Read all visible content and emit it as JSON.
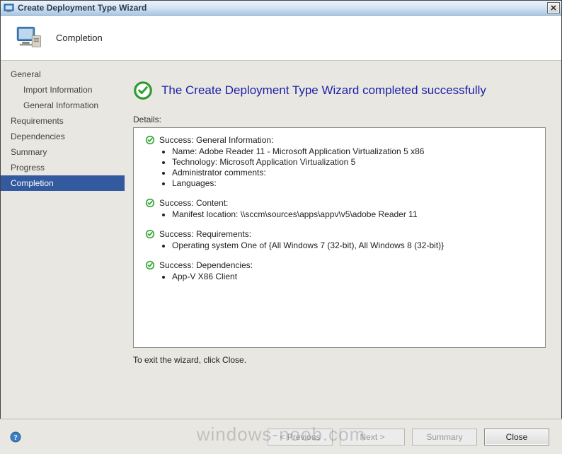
{
  "window": {
    "title": "Create Deployment Type Wizard",
    "close_glyph": "✕"
  },
  "header": {
    "heading": "Completion"
  },
  "sidebar": {
    "items": [
      {
        "label": "General",
        "sub": false
      },
      {
        "label": "Import Information",
        "sub": true
      },
      {
        "label": "General Information",
        "sub": true
      },
      {
        "label": "Requirements",
        "sub": false
      },
      {
        "label": "Dependencies",
        "sub": false
      },
      {
        "label": "Summary",
        "sub": false
      },
      {
        "label": "Progress",
        "sub": false
      },
      {
        "label": "Completion",
        "sub": false,
        "selected": true
      }
    ]
  },
  "successMessage": "The Create Deployment Type Wizard completed successfully",
  "detailsLabel": "Details:",
  "details": [
    {
      "title": "Success: General Information:",
      "lines": [
        "Name: Adobe Reader 11 - Microsoft Application Virtualization 5 x86",
        "Technology: Microsoft Application Virtualization 5",
        "Administrator comments:",
        "Languages:"
      ]
    },
    {
      "title": "Success: Content:",
      "lines": [
        "Manifest location: \\\\sccm\\sources\\apps\\appv\\v5\\adobe Reader 11"
      ]
    },
    {
      "title": "Success: Requirements:",
      "lines": [
        "Operating system  One of  {All Windows 7 (32-bit), All Windows 8 (32-bit)}"
      ]
    },
    {
      "title": "Success: Dependencies:",
      "lines": [
        "App-V X86 Client"
      ]
    }
  ],
  "exitText": "To exit the wizard, click Close.",
  "buttons": {
    "previous": "< Previous",
    "next": "Next >",
    "summary": "Summary",
    "close": "Close"
  },
  "watermark": "windows-noob.com"
}
